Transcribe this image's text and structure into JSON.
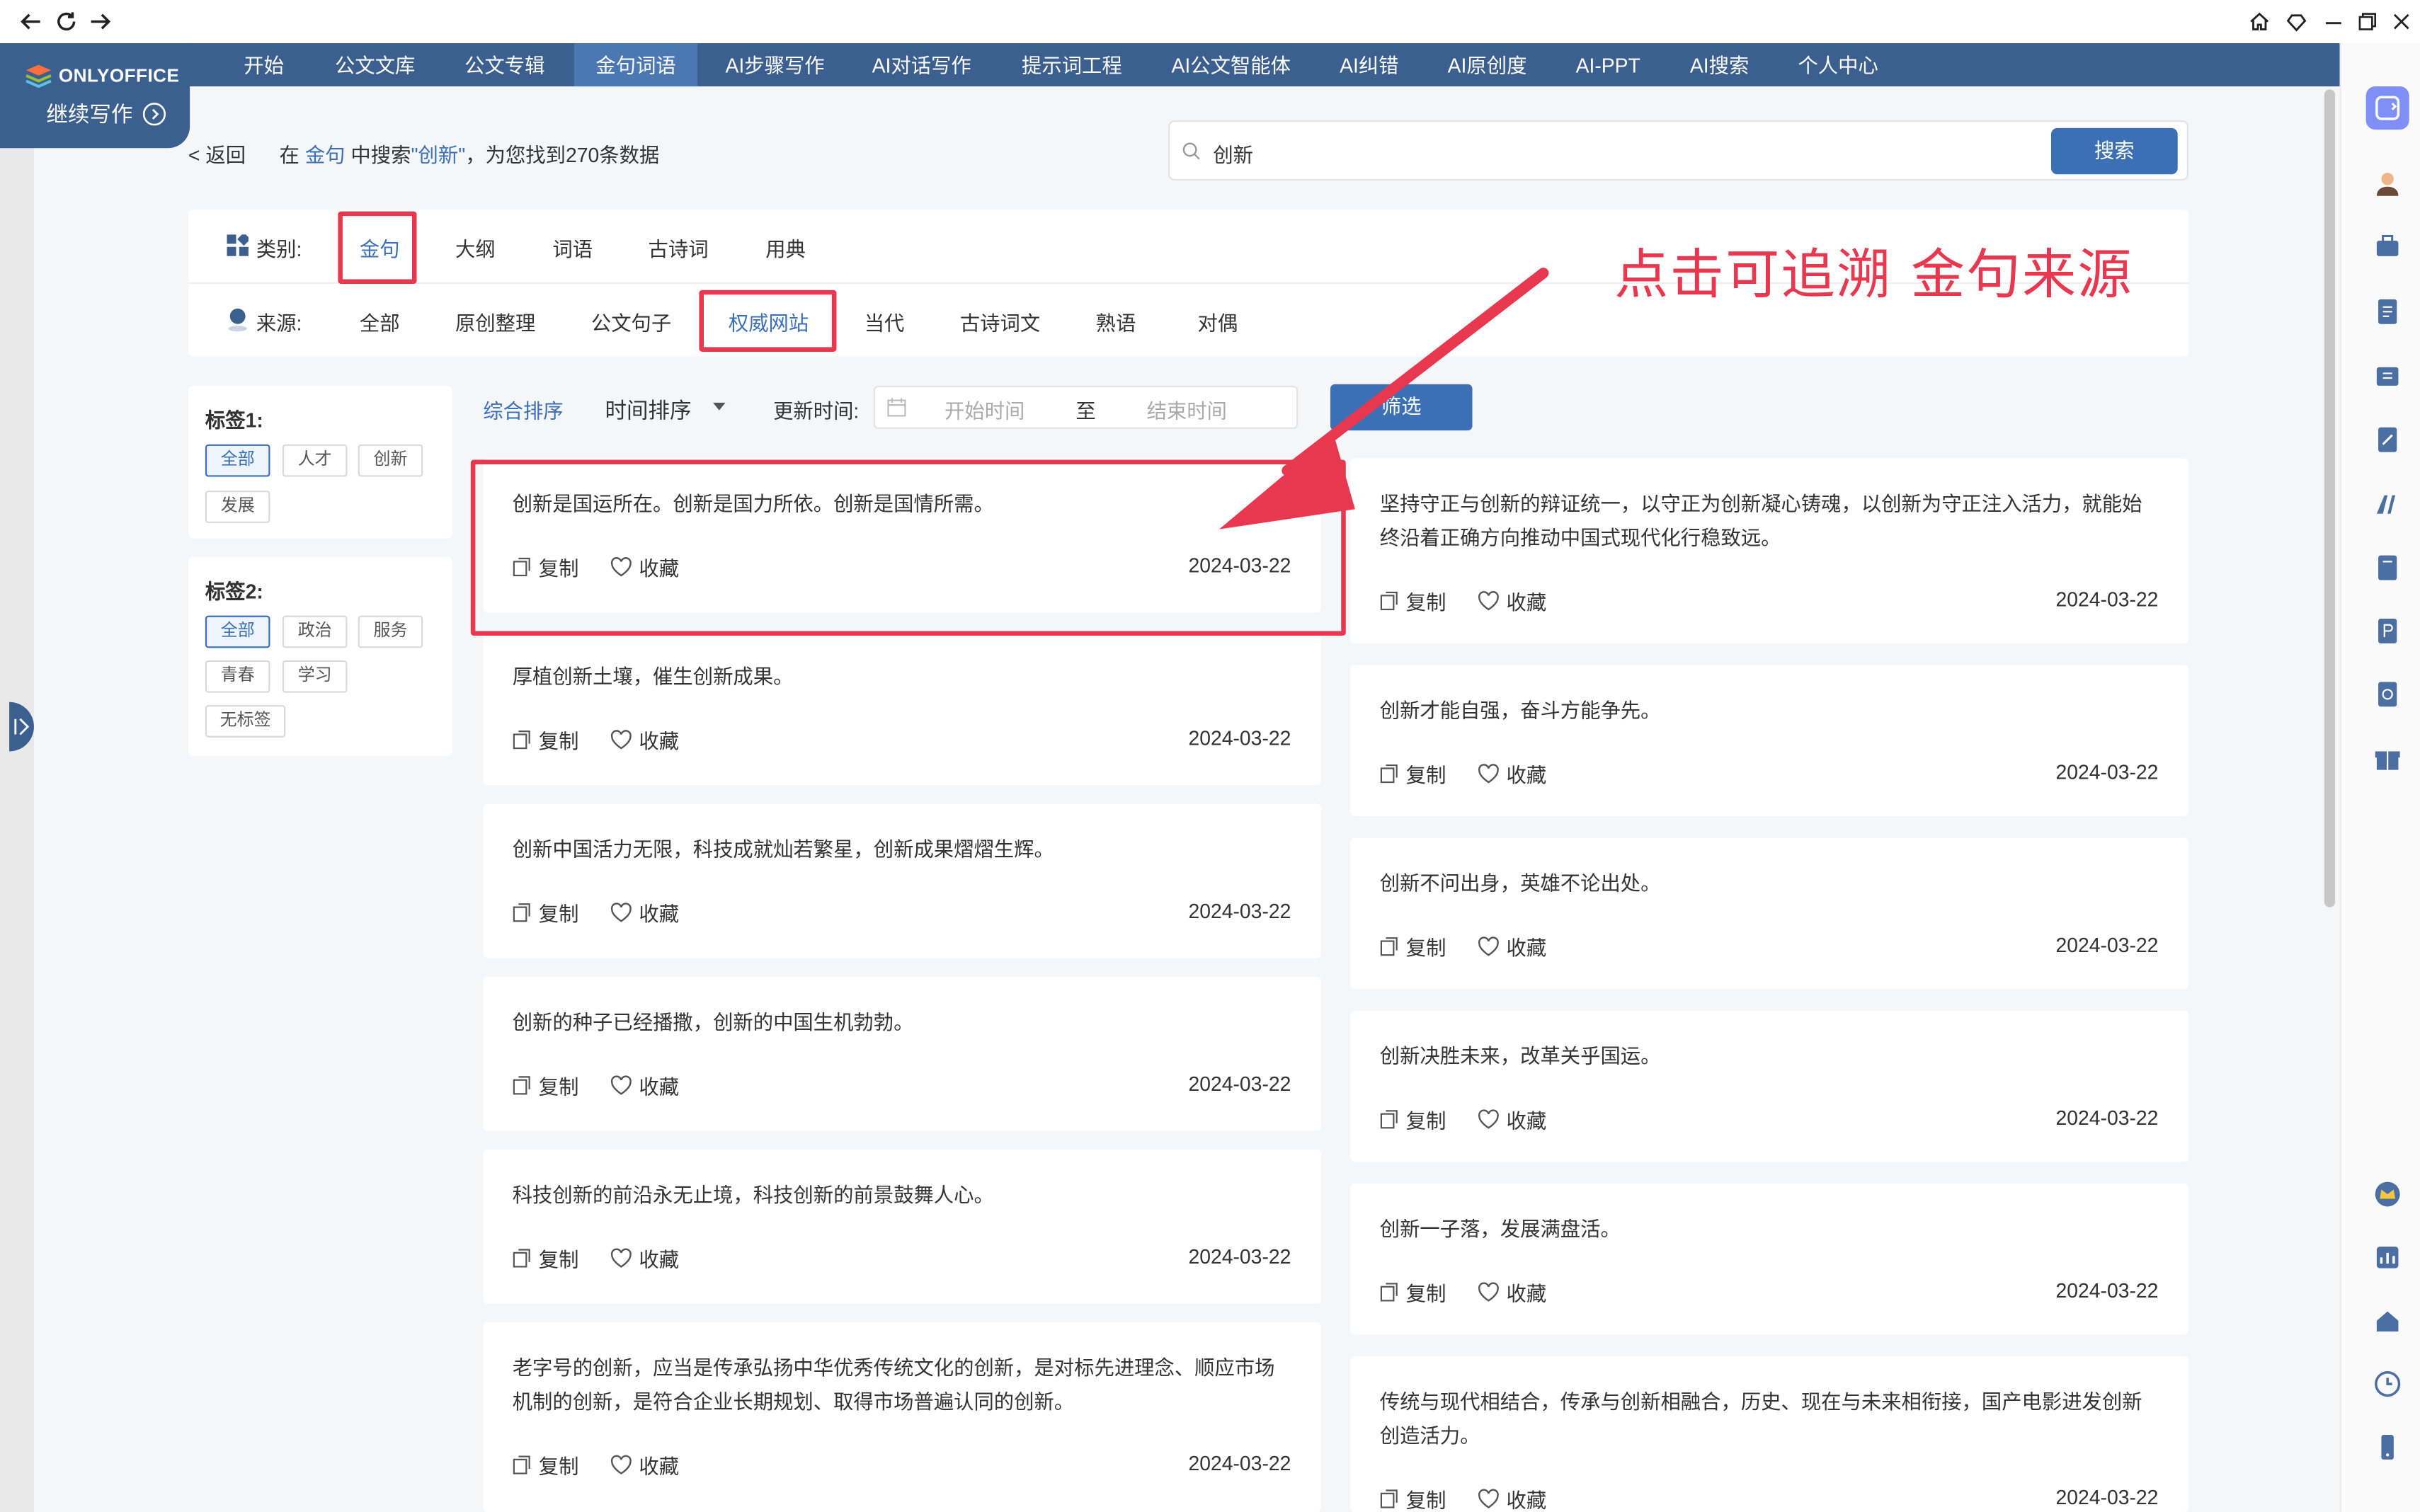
{
  "nav": {
    "items": [
      "开始",
      "公文文库",
      "公文专辑",
      "金句词语",
      "AI步骤写作",
      "AI对话写作",
      "提示词工程",
      "AI公文智能体",
      "AI纠错",
      "AI原创度",
      "AI-PPT",
      "AI搜索",
      "个人中心"
    ],
    "active": "金句词语"
  },
  "logo": {
    "text": "ONLYOFFICE"
  },
  "continue_label": "继续写作",
  "back_label": "< 返回",
  "breadcrumb": {
    "prefix": "在",
    "category": "金句",
    "middle": "中搜索",
    "keyword": "\"创新\"",
    "suffix": "，为您找到270条数据"
  },
  "search": {
    "value": "创新",
    "button": "搜索"
  },
  "filters": {
    "category_label": "类别:",
    "categories": [
      "金句",
      "大纲",
      "词语",
      "古诗词",
      "用典"
    ],
    "category_selected": "金句",
    "source_label": "来源:",
    "sources": [
      "全部",
      "原创整理",
      "公文句子",
      "权威网站",
      "当代",
      "古诗词文",
      "熟语",
      "对偶"
    ],
    "source_selected": "权威网站"
  },
  "tags1": {
    "title": "标签1:",
    "items": [
      "全部",
      "人才",
      "创新",
      "发展"
    ],
    "selected": "全部"
  },
  "tags2": {
    "title": "标签2:",
    "items": [
      "全部",
      "政治",
      "服务",
      "青春",
      "学习",
      "无标签"
    ],
    "selected": "全部"
  },
  "sort": {
    "comprehensive": "综合排序",
    "time": "时间排序",
    "update_label": "更新时间:",
    "start_placeholder": "开始时间",
    "to": "至",
    "end_placeholder": "结束时间",
    "filter_button": "筛选"
  },
  "actions": {
    "copy": "复制",
    "favorite": "收藏"
  },
  "cards": [
    {
      "text": "创新是国运所在。创新是国力所依。创新是国情所需。",
      "date": "2024-03-22"
    },
    {
      "text": "坚持守正与创新的辩证统一，以守正为创新凝心铸魂，以创新为守正注入活力，就能始终沿着正确方向推动中国式现代化行稳致远。",
      "date": "2024-03-22"
    },
    {
      "text": "厚植创新土壤，催生创新成果。",
      "date": "2024-03-22"
    },
    {
      "text": "创新才能自强，奋斗方能争先。",
      "date": "2024-03-22"
    },
    {
      "text": "创新中国活力无限，科技成就灿若繁星，创新成果熠熠生辉。",
      "date": "2024-03-22"
    },
    {
      "text": "创新不问出身，英雄不论出处。",
      "date": "2024-03-22"
    },
    {
      "text": "创新的种子已经播撒，创新的中国生机勃勃。",
      "date": "2024-03-22"
    },
    {
      "text": "创新决胜未来，改革关乎国运。",
      "date": "2024-03-22"
    },
    {
      "text": "科技创新的前沿永无止境，科技创新的前景鼓舞人心。",
      "date": "2024-03-22"
    },
    {
      "text": "创新一子落，发展满盘活。",
      "date": "2024-03-22"
    },
    {
      "text": "老字号的创新，应当是传承弘扬中华优秀传统文化的创新，是对标先进理念、顺应市场机制的创新，是符合企业长期规划、取得市场普遍认同的创新。",
      "date": "2024-03-22"
    },
    {
      "text": "传统与现代相结合，传承与创新相融合，历史、现在与未来相衔接，国产电影进发创新创造活力。",
      "date": "2024-03-22"
    }
  ],
  "annotation": "点击可追溯 金句来源",
  "colors": {
    "nav": "#3b5f8e",
    "accent": "#3b6fb6",
    "annotation": "#e8384f"
  }
}
